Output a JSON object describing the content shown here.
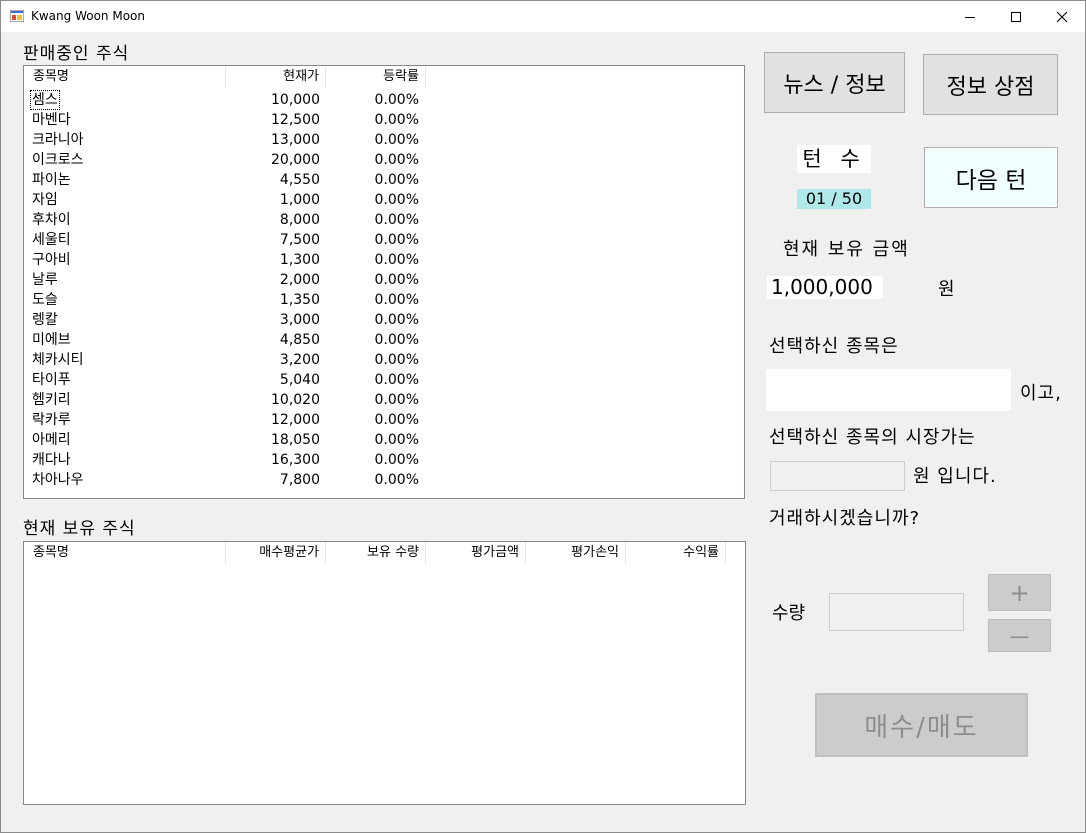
{
  "window": {
    "title": "Kwang Woon Moon"
  },
  "market": {
    "group_label": "판매중인 주식",
    "columns": [
      "종목명",
      "현재가",
      "등락률"
    ],
    "rows": [
      {
        "name": "셈스",
        "price": "10,000",
        "change": "0.00%"
      },
      {
        "name": "마벤다",
        "price": "12,500",
        "change": "0.00%"
      },
      {
        "name": "크라니아",
        "price": "13,000",
        "change": "0.00%"
      },
      {
        "name": "이크로스",
        "price": "20,000",
        "change": "0.00%"
      },
      {
        "name": "파이논",
        "price": "4,550",
        "change": "0.00%"
      },
      {
        "name": "자임",
        "price": "1,000",
        "change": "0.00%"
      },
      {
        "name": "후차이",
        "price": "8,000",
        "change": "0.00%"
      },
      {
        "name": "세울티",
        "price": "7,500",
        "change": "0.00%"
      },
      {
        "name": "구아비",
        "price": "1,300",
        "change": "0.00%"
      },
      {
        "name": "날루",
        "price": "2,000",
        "change": "0.00%"
      },
      {
        "name": "도슬",
        "price": "1,350",
        "change": "0.00%"
      },
      {
        "name": "렝칼",
        "price": "3,000",
        "change": "0.00%"
      },
      {
        "name": "미에브",
        "price": "4,850",
        "change": "0.00%"
      },
      {
        "name": "체카시티",
        "price": "3,200",
        "change": "0.00%"
      },
      {
        "name": "타이푸",
        "price": "5,040",
        "change": "0.00%"
      },
      {
        "name": "헴키리",
        "price": "10,020",
        "change": "0.00%"
      },
      {
        "name": "락카루",
        "price": "12,000",
        "change": "0.00%"
      },
      {
        "name": "아메리",
        "price": "18,050",
        "change": "0.00%"
      },
      {
        "name": "캐다나",
        "price": "16,300",
        "change": "0.00%"
      },
      {
        "name": "차아나우",
        "price": "7,800",
        "change": "0.00%"
      }
    ]
  },
  "holdings": {
    "group_label": "현재 보유 주식",
    "columns": [
      "종목명",
      "매수평균가",
      "보유 수량",
      "평가금액",
      "평가손익",
      "수익률"
    ],
    "rows": []
  },
  "side": {
    "news_button": "뉴스 / 정보",
    "shop_button": "정보 상점",
    "turn_label": "턴 수",
    "turn_value": "01 / 50",
    "next_turn_button": "다음 턴",
    "balance_label": "현재 보유 금액",
    "balance_value": "1,000,000",
    "won_unit": "원",
    "selected_label": "선택하신 종목은",
    "selected_value": "",
    "selected_suffix": "이고,",
    "market_price_label": "선택하신 종목의 시장가는",
    "market_price_value": "",
    "market_price_suffix": "원 입니다.",
    "trade_question": "거래하시겠습니까?",
    "quantity_label": "수량",
    "quantity_value": "",
    "plus_button": "+",
    "minus_button": "—",
    "trade_button": "매수/매도"
  },
  "colors": {
    "turn_value_bg": "#aee8e8",
    "next_turn_bg": "#f0ffff",
    "window_bg": "#f0f0f0"
  }
}
